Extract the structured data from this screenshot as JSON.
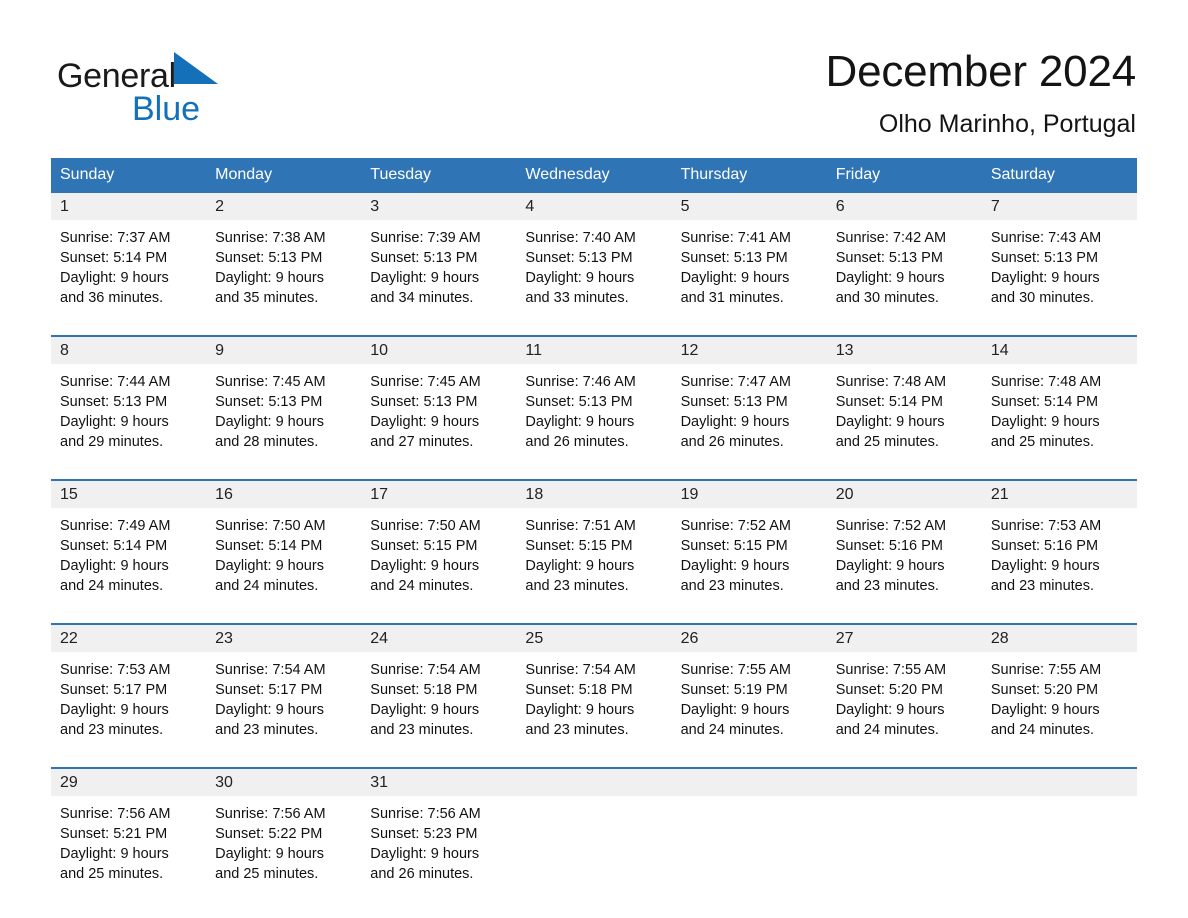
{
  "brand": {
    "name_part1": "General",
    "name_part2": "Blue",
    "triangle_color": "#1470b8"
  },
  "header": {
    "title": "December 2024",
    "subtitle": "Olho Marinho, Portugal",
    "header_bg_color": "#2f75b5",
    "daynum_bg_color": "#f0f0f0"
  },
  "weekdays": [
    "Sunday",
    "Monday",
    "Tuesday",
    "Wednesday",
    "Thursday",
    "Friday",
    "Saturday"
  ],
  "labels": {
    "sunrise_prefix": "Sunrise:",
    "sunset_prefix": "Sunset:",
    "daylight_prefix": "Daylight:"
  },
  "weeks": [
    [
      {
        "day": "1",
        "sunrise": "Sunrise: 7:37 AM",
        "sunset": "Sunset: 5:14 PM",
        "daylight_line1": "Daylight: 9 hours",
        "daylight_line2": "and 36 minutes."
      },
      {
        "day": "2",
        "sunrise": "Sunrise: 7:38 AM",
        "sunset": "Sunset: 5:13 PM",
        "daylight_line1": "Daylight: 9 hours",
        "daylight_line2": "and 35 minutes."
      },
      {
        "day": "3",
        "sunrise": "Sunrise: 7:39 AM",
        "sunset": "Sunset: 5:13 PM",
        "daylight_line1": "Daylight: 9 hours",
        "daylight_line2": "and 34 minutes."
      },
      {
        "day": "4",
        "sunrise": "Sunrise: 7:40 AM",
        "sunset": "Sunset: 5:13 PM",
        "daylight_line1": "Daylight: 9 hours",
        "daylight_line2": "and 33 minutes."
      },
      {
        "day": "5",
        "sunrise": "Sunrise: 7:41 AM",
        "sunset": "Sunset: 5:13 PM",
        "daylight_line1": "Daylight: 9 hours",
        "daylight_line2": "and 31 minutes."
      },
      {
        "day": "6",
        "sunrise": "Sunrise: 7:42 AM",
        "sunset": "Sunset: 5:13 PM",
        "daylight_line1": "Daylight: 9 hours",
        "daylight_line2": "and 30 minutes."
      },
      {
        "day": "7",
        "sunrise": "Sunrise: 7:43 AM",
        "sunset": "Sunset: 5:13 PM",
        "daylight_line1": "Daylight: 9 hours",
        "daylight_line2": "and 30 minutes."
      }
    ],
    [
      {
        "day": "8",
        "sunrise": "Sunrise: 7:44 AM",
        "sunset": "Sunset: 5:13 PM",
        "daylight_line1": "Daylight: 9 hours",
        "daylight_line2": "and 29 minutes."
      },
      {
        "day": "9",
        "sunrise": "Sunrise: 7:45 AM",
        "sunset": "Sunset: 5:13 PM",
        "daylight_line1": "Daylight: 9 hours",
        "daylight_line2": "and 28 minutes."
      },
      {
        "day": "10",
        "sunrise": "Sunrise: 7:45 AM",
        "sunset": "Sunset: 5:13 PM",
        "daylight_line1": "Daylight: 9 hours",
        "daylight_line2": "and 27 minutes."
      },
      {
        "day": "11",
        "sunrise": "Sunrise: 7:46 AM",
        "sunset": "Sunset: 5:13 PM",
        "daylight_line1": "Daylight: 9 hours",
        "daylight_line2": "and 26 minutes."
      },
      {
        "day": "12",
        "sunrise": "Sunrise: 7:47 AM",
        "sunset": "Sunset: 5:13 PM",
        "daylight_line1": "Daylight: 9 hours",
        "daylight_line2": "and 26 minutes."
      },
      {
        "day": "13",
        "sunrise": "Sunrise: 7:48 AM",
        "sunset": "Sunset: 5:14 PM",
        "daylight_line1": "Daylight: 9 hours",
        "daylight_line2": "and 25 minutes."
      },
      {
        "day": "14",
        "sunrise": "Sunrise: 7:48 AM",
        "sunset": "Sunset: 5:14 PM",
        "daylight_line1": "Daylight: 9 hours",
        "daylight_line2": "and 25 minutes."
      }
    ],
    [
      {
        "day": "15",
        "sunrise": "Sunrise: 7:49 AM",
        "sunset": "Sunset: 5:14 PM",
        "daylight_line1": "Daylight: 9 hours",
        "daylight_line2": "and 24 minutes."
      },
      {
        "day": "16",
        "sunrise": "Sunrise: 7:50 AM",
        "sunset": "Sunset: 5:14 PM",
        "daylight_line1": "Daylight: 9 hours",
        "daylight_line2": "and 24 minutes."
      },
      {
        "day": "17",
        "sunrise": "Sunrise: 7:50 AM",
        "sunset": "Sunset: 5:15 PM",
        "daylight_line1": "Daylight: 9 hours",
        "daylight_line2": "and 24 minutes."
      },
      {
        "day": "18",
        "sunrise": "Sunrise: 7:51 AM",
        "sunset": "Sunset: 5:15 PM",
        "daylight_line1": "Daylight: 9 hours",
        "daylight_line2": "and 23 minutes."
      },
      {
        "day": "19",
        "sunrise": "Sunrise: 7:52 AM",
        "sunset": "Sunset: 5:15 PM",
        "daylight_line1": "Daylight: 9 hours",
        "daylight_line2": "and 23 minutes."
      },
      {
        "day": "20",
        "sunrise": "Sunrise: 7:52 AM",
        "sunset": "Sunset: 5:16 PM",
        "daylight_line1": "Daylight: 9 hours",
        "daylight_line2": "and 23 minutes."
      },
      {
        "day": "21",
        "sunrise": "Sunrise: 7:53 AM",
        "sunset": "Sunset: 5:16 PM",
        "daylight_line1": "Daylight: 9 hours",
        "daylight_line2": "and 23 minutes."
      }
    ],
    [
      {
        "day": "22",
        "sunrise": "Sunrise: 7:53 AM",
        "sunset": "Sunset: 5:17 PM",
        "daylight_line1": "Daylight: 9 hours",
        "daylight_line2": "and 23 minutes."
      },
      {
        "day": "23",
        "sunrise": "Sunrise: 7:54 AM",
        "sunset": "Sunset: 5:17 PM",
        "daylight_line1": "Daylight: 9 hours",
        "daylight_line2": "and 23 minutes."
      },
      {
        "day": "24",
        "sunrise": "Sunrise: 7:54 AM",
        "sunset": "Sunset: 5:18 PM",
        "daylight_line1": "Daylight: 9 hours",
        "daylight_line2": "and 23 minutes."
      },
      {
        "day": "25",
        "sunrise": "Sunrise: 7:54 AM",
        "sunset": "Sunset: 5:18 PM",
        "daylight_line1": "Daylight: 9 hours",
        "daylight_line2": "and 23 minutes."
      },
      {
        "day": "26",
        "sunrise": "Sunrise: 7:55 AM",
        "sunset": "Sunset: 5:19 PM",
        "daylight_line1": "Daylight: 9 hours",
        "daylight_line2": "and 24 minutes."
      },
      {
        "day": "27",
        "sunrise": "Sunrise: 7:55 AM",
        "sunset": "Sunset: 5:20 PM",
        "daylight_line1": "Daylight: 9 hours",
        "daylight_line2": "and 24 minutes."
      },
      {
        "day": "28",
        "sunrise": "Sunrise: 7:55 AM",
        "sunset": "Sunset: 5:20 PM",
        "daylight_line1": "Daylight: 9 hours",
        "daylight_line2": "and 24 minutes."
      }
    ],
    [
      {
        "day": "29",
        "sunrise": "Sunrise: 7:56 AM",
        "sunset": "Sunset: 5:21 PM",
        "daylight_line1": "Daylight: 9 hours",
        "daylight_line2": "and 25 minutes."
      },
      {
        "day": "30",
        "sunrise": "Sunrise: 7:56 AM",
        "sunset": "Sunset: 5:22 PM",
        "daylight_line1": "Daylight: 9 hours",
        "daylight_line2": "and 25 minutes."
      },
      {
        "day": "31",
        "sunrise": "Sunrise: 7:56 AM",
        "sunset": "Sunset: 5:23 PM",
        "daylight_line1": "Daylight: 9 hours",
        "daylight_line2": "and 26 minutes."
      },
      {
        "day": "",
        "sunrise": "",
        "sunset": "",
        "daylight_line1": "",
        "daylight_line2": ""
      },
      {
        "day": "",
        "sunrise": "",
        "sunset": "",
        "daylight_line1": "",
        "daylight_line2": ""
      },
      {
        "day": "",
        "sunrise": "",
        "sunset": "",
        "daylight_line1": "",
        "daylight_line2": ""
      },
      {
        "day": "",
        "sunrise": "",
        "sunset": "",
        "daylight_line1": "",
        "daylight_line2": ""
      }
    ]
  ]
}
